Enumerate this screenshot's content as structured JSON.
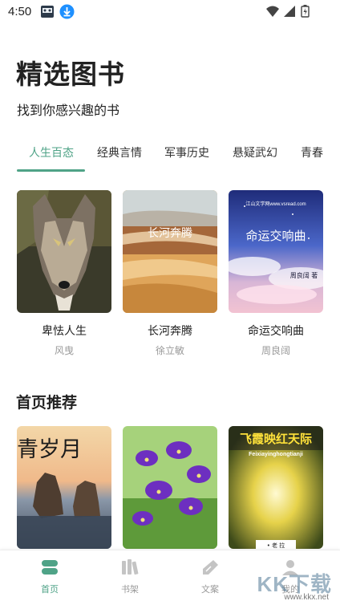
{
  "status_bar": {
    "time": "4:50"
  },
  "header": {
    "title": "精选图书",
    "subtitle": "找到你感兴趣的书"
  },
  "tabs": [
    {
      "label": "人生百态",
      "active": true
    },
    {
      "label": "经典言情",
      "active": false
    },
    {
      "label": "军事历史",
      "active": false
    },
    {
      "label": "悬疑武幻",
      "active": false
    },
    {
      "label": "青春",
      "active": false
    }
  ],
  "featured_books": [
    {
      "title": "卑怯人生",
      "author": "风曳"
    },
    {
      "title": "长河奔腾",
      "author": "徐立敏",
      "cover_text": "长河奔腾"
    },
    {
      "title": "命运交响曲",
      "author": "周良阔",
      "cover_text": "命运交响曲",
      "cover_site": "江山文学网www.vsread.com",
      "cover_author": "周良阔 著"
    }
  ],
  "recommend": {
    "section_title": "首页推荐",
    "books": [
      {
        "cover_text": "青岁月"
      },
      {
        "cover_text": ""
      },
      {
        "cover_text": "飞霞映红天际",
        "cover_pinyin": "Feixiayinghongtianji",
        "cover_author": "• 老 拉"
      }
    ]
  },
  "bottom_nav": [
    {
      "label": "首页",
      "icon": "home-icon",
      "active": true
    },
    {
      "label": "书架",
      "icon": "bookshelf-icon",
      "active": false
    },
    {
      "label": "文案",
      "icon": "pen-icon",
      "active": false
    },
    {
      "label": "我的",
      "icon": "profile-icon",
      "active": false
    }
  ],
  "watermark": {
    "text": "KK下载",
    "url": "www.kkx.net"
  },
  "colors": {
    "accent": "#4fa387",
    "muted": "#999999"
  }
}
